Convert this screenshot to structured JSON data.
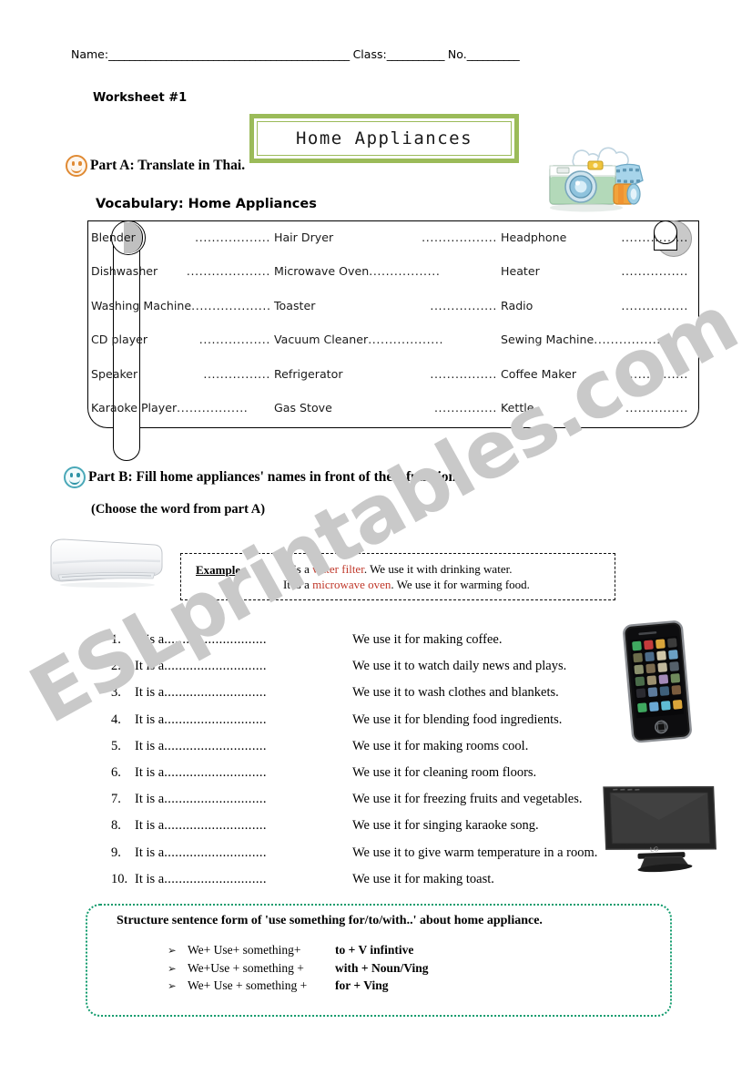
{
  "header": {
    "name_label": "Name:",
    "name_blank": "______________________________________________",
    "class_label": "Class:",
    "class_blank": "___________",
    "no_label": "No.",
    "no_blank": "__________",
    "worksheet_number": "Worksheet #1"
  },
  "title": {
    "text": "Home Appliances",
    "border_color": "#9bbb59"
  },
  "part_a": {
    "label": "Part A:  Translate in Thai.",
    "smiley_color": "#e08a33",
    "vocab_heading": "Vocabulary: Home Appliances",
    "dots": ".................",
    "dots_long": "...................",
    "columns": [
      [
        {
          "word": "Blender",
          "dots": "..................",
          "inline": false
        },
        {
          "word": "Dishwasher",
          "dots": "....................",
          "inline": false
        },
        {
          "word": "Washing Machine",
          "dots": "...................",
          "inline": true
        },
        {
          "word": "CD player",
          "dots": ".................",
          "inline": false
        },
        {
          "word": "Speaker",
          "dots": "................",
          "inline": false
        },
        {
          "word": "Karaoke Player",
          "dots": ".................",
          "inline": true
        }
      ],
      [
        {
          "word": "Hair Dryer",
          "dots": "..................",
          "inline": false
        },
        {
          "word": "Microwave Oven",
          "dots": ".................",
          "inline": true
        },
        {
          "word": "Toaster",
          "dots": "................",
          "inline": false
        },
        {
          "word": "Vacuum Cleaner",
          "dots": "..................",
          "inline": true
        },
        {
          "word": "Refrigerator",
          "dots": "................",
          "inline": false
        },
        {
          "word": "Gas Stove",
          "dots": "...............",
          "inline": false
        }
      ],
      [
        {
          "word": "Headphone",
          "dots": "................",
          "inline": false
        },
        {
          "word": "Heater",
          "dots": "................",
          "inline": false
        },
        {
          "word": "Radio",
          "dots": "................",
          "inline": false
        },
        {
          "word": "Sewing Machine",
          "dots": "..................",
          "inline": true
        },
        {
          "word": "Coffee Maker",
          "dots": "................",
          "inline": false
        },
        {
          "word": "Kettle",
          "dots": "...............",
          "inline": false
        }
      ]
    ]
  },
  "part_b": {
    "label": "Part B: Fill home appliances' names in front of their functions.",
    "smiley_color": "#4aa8b8",
    "note": "(Choose the word from part A)",
    "example": {
      "label": "Example:",
      "line1_pre": "It is a ",
      "line1_red": "water filter",
      "line1_post": ". We use it with drinking water.",
      "line2_pre": "It is a ",
      "line2_red": "microwave oven",
      "line2_post": ". We use it for warming food."
    },
    "stem": "It is a",
    "stem_dots": "............................",
    "items": [
      {
        "num": "1.",
        "function": "We use it for making coffee."
      },
      {
        "num": "2.",
        "function": "We use it to watch daily news and plays."
      },
      {
        "num": "3.",
        "function": "We use it to wash clothes and blankets."
      },
      {
        "num": "4.",
        "function": "We use it for blending food ingredients."
      },
      {
        "num": "5.",
        "function": "We use it for making rooms cool."
      },
      {
        "num": "6.",
        "function": "We use it for cleaning room floors."
      },
      {
        "num": "7.",
        "function": "We use it for freezing fruits and vegetables."
      },
      {
        "num": "8.",
        "function": "We use it for singing karaoke song."
      },
      {
        "num": "9.",
        "function": "We use it to give warm temperature in a room."
      },
      {
        "num": "10.",
        "function": "We use it for making toast."
      }
    ]
  },
  "structure": {
    "title": "Structure sentence form of 'use something for/to/with..' about home appliance.",
    "border_color": "#0f9b6c",
    "bullet_glyph": "➢",
    "rows": [
      {
        "left": "We+ Use+ something+",
        "right": "to + V infintive"
      },
      {
        "left": "We+Use + something +",
        "right": "with + Noun/Ving"
      },
      {
        "left": "We+ Use + something +",
        "right": "for + Ving"
      }
    ]
  },
  "watermark": {
    "text": "ESLprintables.com"
  },
  "clipart": {
    "camera": "camera-clipart",
    "air_conditioner": "air-conditioner-photo",
    "phone": "smartphone-photo",
    "tv": "flat-screen-tv-photo"
  }
}
